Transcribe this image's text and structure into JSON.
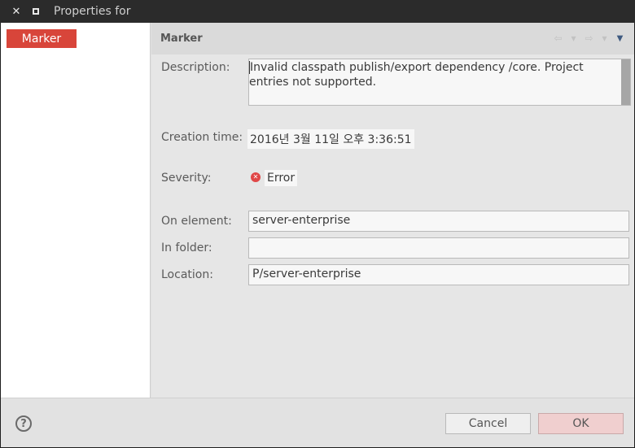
{
  "window": {
    "title": "Properties for"
  },
  "sidebar": {
    "items": [
      {
        "label": "Marker"
      }
    ]
  },
  "page": {
    "title": "Marker"
  },
  "fields": {
    "description": {
      "label": "Description:",
      "value": "Invalid classpath publish/export dependency /core. Project entries not supported."
    },
    "creation_time": {
      "label": "Creation time:",
      "value": "2016년 3월 11일 오후 3:36:51"
    },
    "severity": {
      "label": "Severity:",
      "value": "Error"
    },
    "on_element": {
      "label": "On element:",
      "value": "server-enterprise"
    },
    "in_folder": {
      "label": "In folder:",
      "value": ""
    },
    "location": {
      "label": "Location:",
      "value": "P/server-enterprise"
    }
  },
  "buttons": {
    "cancel": "Cancel",
    "ok": "OK",
    "help": "?"
  },
  "colors": {
    "accent": "#d8453a",
    "ok_button": "#f0cfcf",
    "error_icon": "#e04747"
  }
}
